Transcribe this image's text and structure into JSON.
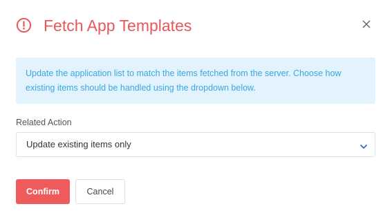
{
  "dialog": {
    "title": "Fetch App Templates",
    "title_icon": "alert-circle-icon",
    "close_icon": "close-icon",
    "accent_color": "#e8575a"
  },
  "info": {
    "text": "Update the application list to match the items fetched from the server. Choose how existing items should be handled using the dropdown below."
  },
  "related_action": {
    "label": "Related Action",
    "selected": "Update existing items only",
    "chevron_icon": "chevron-down-icon"
  },
  "buttons": {
    "confirm": "Confirm",
    "cancel": "Cancel"
  }
}
